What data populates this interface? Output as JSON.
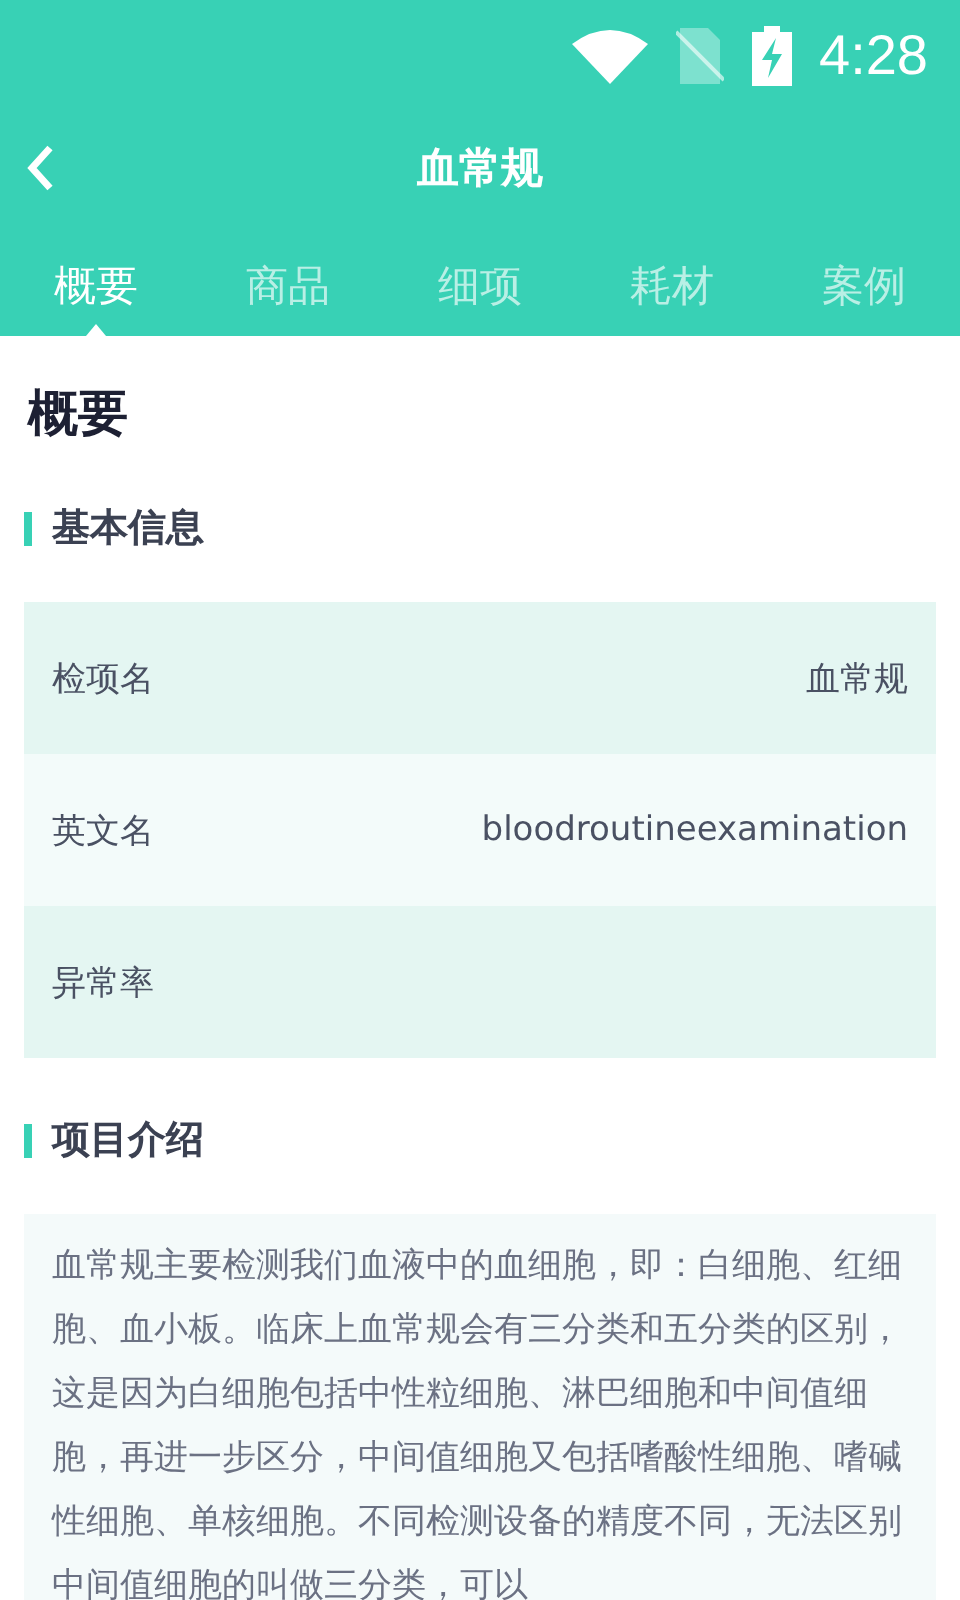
{
  "status_bar": {
    "time": "4:28"
  },
  "header": {
    "title": "血常规"
  },
  "tabs": [
    {
      "label": "概要",
      "selected": true
    },
    {
      "label": "商品",
      "selected": false
    },
    {
      "label": "细项",
      "selected": false
    },
    {
      "label": "耗材",
      "selected": false
    },
    {
      "label": "案例",
      "selected": false
    }
  ],
  "page_title": "概要",
  "basic_info": {
    "heading": "基本信息",
    "rows": [
      {
        "label": "检项名",
        "value": "血常规"
      },
      {
        "label": "英文名",
        "value": "bloodroutineexamination"
      },
      {
        "label": "异常率"
      }
    ]
  },
  "intro": {
    "heading": "项目介绍",
    "text": "血常规主要检测我们血液中的血细胞，即：白细胞、红细胞、血小板。临床上血常规会有三分类和五分类的区别，这是因为白细胞包括中性粒细胞、淋巴细胞和中间值细胞，再进一步区分，中间值细胞又包括嗜酸性细胞、嗜碱性细胞、单核细胞。不同检测设备的精度不同，无法区别中间值细胞的叫做三分类，可以"
  }
}
